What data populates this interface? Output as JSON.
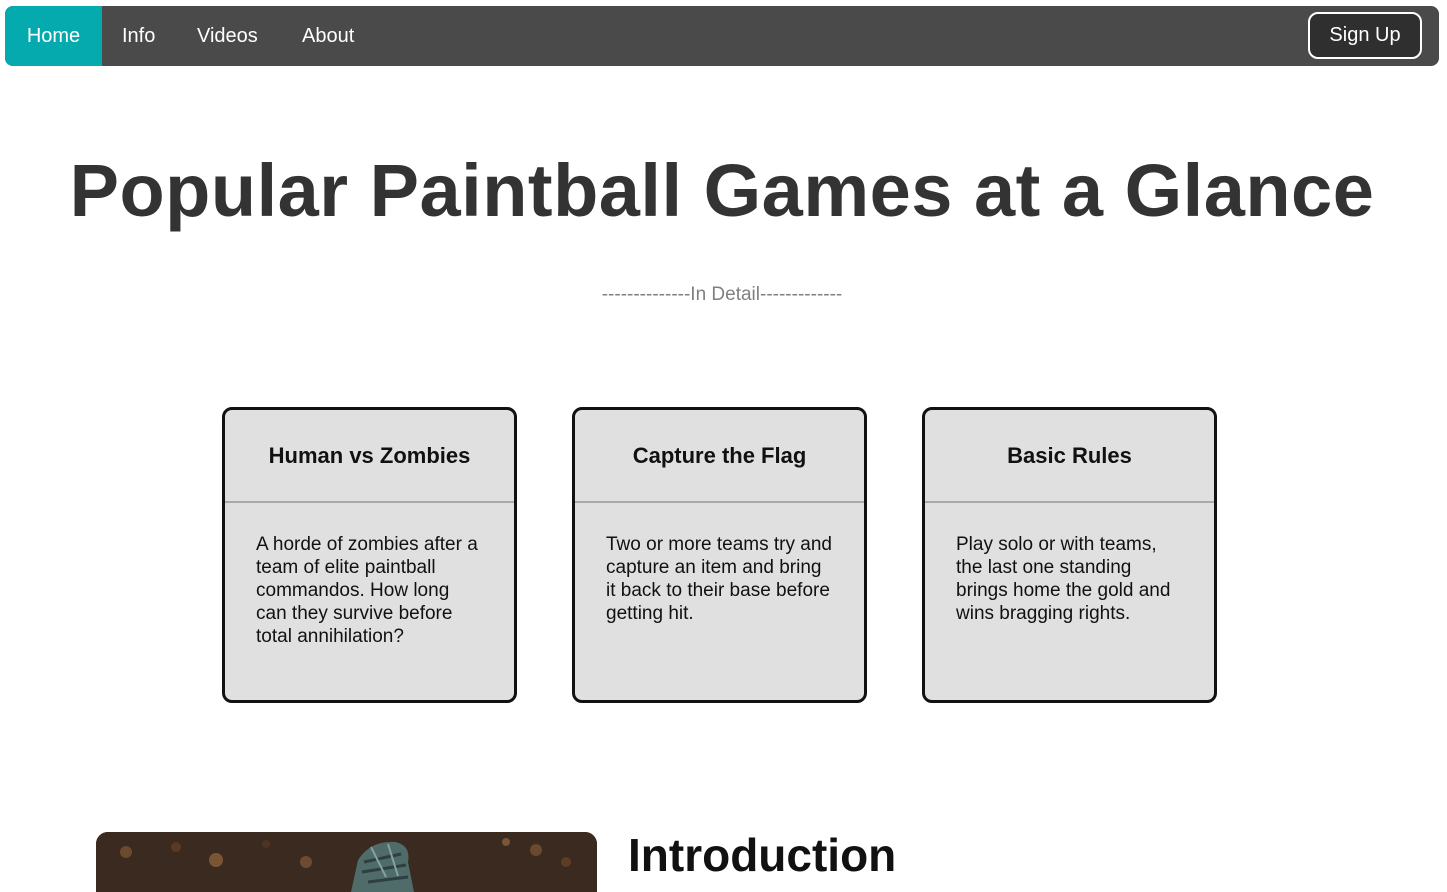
{
  "nav": {
    "items": [
      {
        "label": "Home",
        "active": true
      },
      {
        "label": "Info",
        "active": false
      },
      {
        "label": "Videos",
        "active": false
      },
      {
        "label": "About",
        "active": false
      }
    ],
    "signup_label": "Sign Up",
    "colors": {
      "bar": "#4a4a4a",
      "active": "#04aaad"
    }
  },
  "hero": {
    "title": "Popular Paintball Games at a Glance",
    "subtitle": "--------------In Detail-------------"
  },
  "cards": [
    {
      "title": "Human vs Zombies",
      "text": "A horde of zombies after a team of elite paintball commandos. How long can they survive before total annihilation?"
    },
    {
      "title": "Capture the Flag",
      "text": "Two or more teams try and capture an item and bring it back to their base before getting hit."
    },
    {
      "title": "Basic Rules",
      "text": "Play solo or with teams, the last one standing brings home the gold and wins bragging rights."
    }
  ],
  "intro": {
    "title": "Introduction"
  }
}
